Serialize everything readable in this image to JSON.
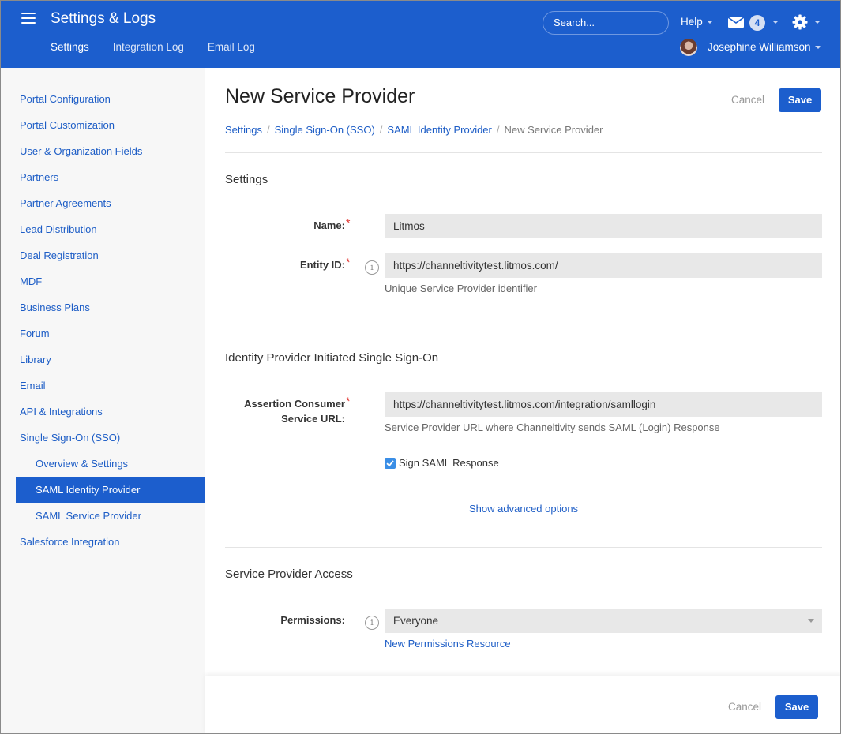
{
  "header": {
    "app_title": "Settings & Logs",
    "subnav": [
      {
        "label": "Settings",
        "active": true
      },
      {
        "label": "Integration Log",
        "active": false
      },
      {
        "label": "Email Log",
        "active": false
      }
    ],
    "search_placeholder": "Search...",
    "help_label": "Help",
    "mail_count": "4",
    "user_name": "Josephine Williamson",
    "icons": [
      "menu-icon",
      "mail-icon",
      "gear-icon"
    ],
    "brand_color": "#1c5ecd"
  },
  "sidebar": {
    "items": [
      {
        "label": "Portal Configuration",
        "level": 1
      },
      {
        "label": "Portal Customization",
        "level": 1
      },
      {
        "label": "User & Organization Fields",
        "level": 1
      },
      {
        "label": "Partners",
        "level": 1
      },
      {
        "label": "Partner Agreements",
        "level": 1
      },
      {
        "label": "Lead Distribution",
        "level": 1
      },
      {
        "label": "Deal Registration",
        "level": 1
      },
      {
        "label": "MDF",
        "level": 1
      },
      {
        "label": "Business Plans",
        "level": 1
      },
      {
        "label": "Forum",
        "level": 1
      },
      {
        "label": "Library",
        "level": 1
      },
      {
        "label": "Email",
        "level": 1
      },
      {
        "label": "API & Integrations",
        "level": 1
      },
      {
        "label": "Single Sign-On (SSO)",
        "level": 1
      },
      {
        "label": "Overview & Settings",
        "level": 2
      },
      {
        "label": "SAML Identity Provider",
        "level": 2,
        "active": true
      },
      {
        "label": "SAML Service Provider",
        "level": 2
      },
      {
        "label": "Salesforce Integration",
        "level": 1
      }
    ]
  },
  "main": {
    "title": "New Service Provider",
    "cancel_label": "Cancel",
    "save_label": "Save",
    "breadcrumb": [
      "Settings",
      "Single Sign-On (SSO)",
      "SAML Identity Provider",
      "New Service Provider"
    ],
    "sections": {
      "settings": {
        "title": "Settings",
        "name_label": "Name:",
        "name_value": "Litmos",
        "entity_label": "Entity ID:",
        "entity_value": "https://channeltivitytest.litmos.com/",
        "entity_help": "Unique Service Provider identifier"
      },
      "idp": {
        "title": "Identity Provider Initiated Single Sign-On",
        "acs_label_line1": "Assertion Consumer",
        "acs_label_line2": "Service URL:",
        "acs_value": "https://channeltivitytest.litmos.com/integration/samllogin",
        "acs_help": "Service Provider URL where Channeltivity sends SAML (Login) Response",
        "sign_label": "Sign SAML Response",
        "sign_checked": true,
        "advanced_link": "Show advanced options"
      },
      "access": {
        "title": "Service Provider Access",
        "permissions_label": "Permissions:",
        "permissions_value": "Everyone",
        "new_permissions_link": "New Permissions Resource"
      }
    }
  },
  "footer": {
    "cancel_label": "Cancel",
    "save_label": "Save"
  }
}
